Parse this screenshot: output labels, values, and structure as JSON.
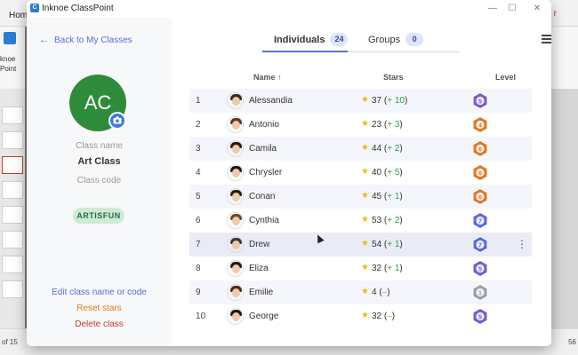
{
  "background": {
    "home_tab": "Hom",
    "ribbon_label_1": "knoe",
    "ribbon_label_2": "Point",
    "status_left": "of 15",
    "status_right": "56"
  },
  "window": {
    "title": "Inknoe ClassPoint",
    "minimize": "—",
    "maximize": "☐",
    "close": "✕"
  },
  "left_panel": {
    "back_label": "Back to My Classes",
    "avatar_initials": "AC",
    "class_name_label": "Class name",
    "class_name": "Art Class",
    "class_code_label": "Class code",
    "class_code": "ARTISFUN",
    "edit_link": "Edit class name or code",
    "reset_link": "Reset stars",
    "delete_link": "Delete class",
    "colors": {
      "accent": "#5a6cd8",
      "avatar": "#2e8b3a",
      "reset": "#e07b1a",
      "delete": "#c0392b"
    }
  },
  "tabs": [
    {
      "label": "Individuals",
      "count": "24",
      "active": true
    },
    {
      "label": "Groups",
      "count": "0",
      "active": false
    }
  ],
  "columns": {
    "name": "Name ↑",
    "stars": "Stars",
    "level": "Level"
  },
  "students": [
    {
      "rank": "1",
      "name": "Alessandia",
      "stars": "37",
      "change": "+ 10",
      "level": "5",
      "badge_color": "#7a5cc7",
      "hair": "#3b2a20"
    },
    {
      "rank": "2",
      "name": "Antonio",
      "stars": "23",
      "change": "+ 3",
      "level": "4",
      "badge_color": "#e0782a",
      "hair": "#5a3a20"
    },
    {
      "rank": "3",
      "name": "Camila",
      "stars": "44",
      "change": "+ 2",
      "level": "6",
      "badge_color": "#e0782a",
      "hair": "#2a1a10"
    },
    {
      "rank": "4",
      "name": "Chrysler",
      "stars": "40",
      "change": "+ 5",
      "level": "6",
      "badge_color": "#e0782a",
      "hair": "#1a1a1a"
    },
    {
      "rank": "5",
      "name": "Conan",
      "stars": "45",
      "change": "+ 1",
      "level": "6",
      "badge_color": "#e0782a",
      "hair": "#2a1a10"
    },
    {
      "rank": "6",
      "name": "Cynthia",
      "stars": "53",
      "change": "+ 2",
      "level": "7",
      "badge_color": "#5a6cd8",
      "hair": "#6a4a2a"
    },
    {
      "rank": "7",
      "name": "Drew",
      "stars": "54",
      "change": "+ 1",
      "level": "7",
      "badge_color": "#5a6cd8",
      "hair": "#3a3a3a"
    },
    {
      "rank": "8",
      "name": "Eliza",
      "stars": "32",
      "change": "+ 1",
      "level": "5",
      "badge_color": "#7a5cc7",
      "hair": "#1a1a1a"
    },
    {
      "rank": "9",
      "name": "Emilie",
      "stars": "4",
      "change": "–",
      "level": "1",
      "badge_color": "#9aa0aa",
      "hair": "#4a2a1a"
    },
    {
      "rank": "10",
      "name": "George",
      "stars": "32",
      "change": "–",
      "level": "5",
      "badge_color": "#7a5cc7",
      "hair": "#1a1a1a"
    }
  ],
  "icons": {
    "back": "arrow-left-icon",
    "camera": "camera-icon",
    "menu": "hamburger-menu-icon",
    "star": "star-icon",
    "more": "more-vertical-icon"
  }
}
